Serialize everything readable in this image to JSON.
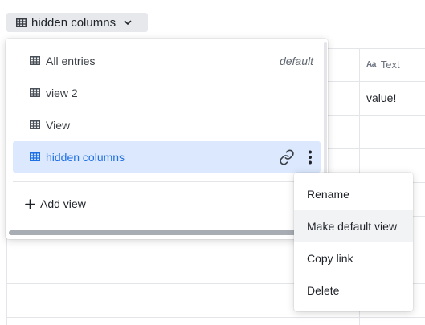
{
  "switcher": {
    "label": "hidden columns",
    "icon": "table-icon"
  },
  "table": {
    "column_header": {
      "label": "Text",
      "type_icon": "Aa"
    },
    "cell_value": "value!"
  },
  "views_panel": {
    "items": [
      {
        "label": "All entries",
        "tag": "default",
        "active": false
      },
      {
        "label": "view 2",
        "tag": "",
        "active": false
      },
      {
        "label": "View",
        "tag": "",
        "active": false
      },
      {
        "label": "hidden columns",
        "tag": "",
        "active": true
      }
    ],
    "add_view_label": "Add view"
  },
  "context_menu": {
    "items": [
      {
        "label": "Rename"
      },
      {
        "label": "Make default view"
      },
      {
        "label": "Copy link"
      },
      {
        "label": "Delete"
      }
    ]
  },
  "colors": {
    "accent": "#1f6fe5",
    "active_bg": "#dbe8fd",
    "switcher_bg": "#e6e8eb",
    "border": "#e3e5e8"
  }
}
